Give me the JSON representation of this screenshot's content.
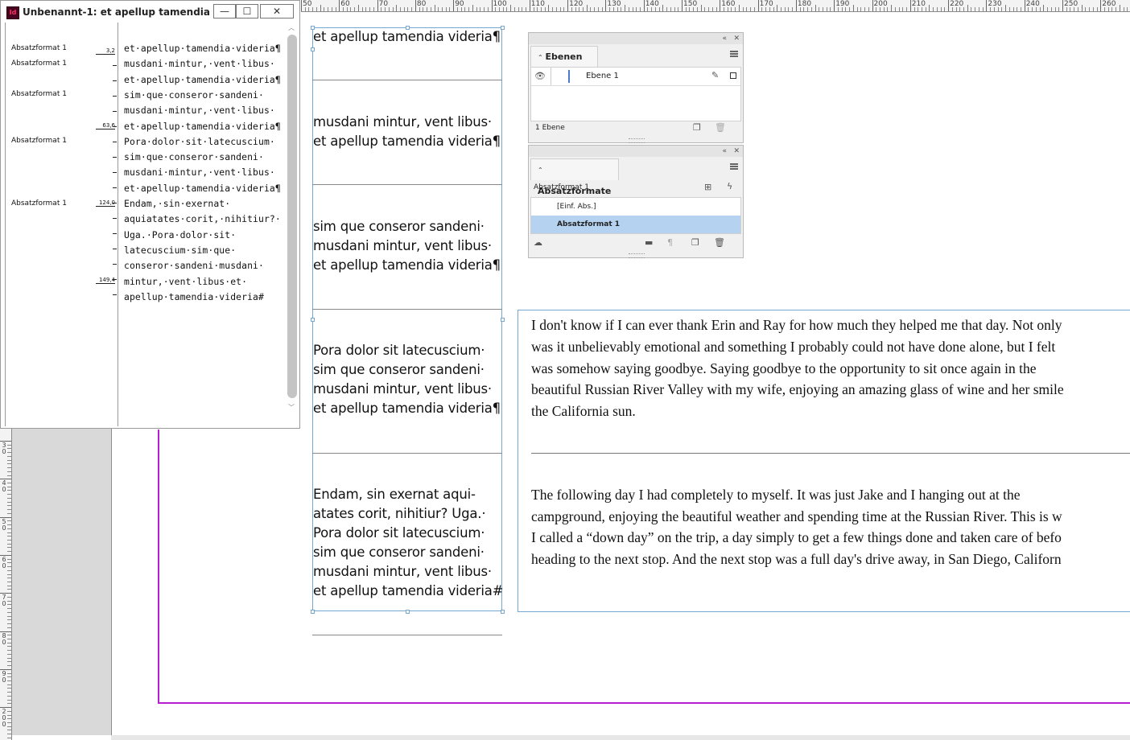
{
  "story_editor": {
    "title": "Unbenannt-1: et apellup tamendia ...",
    "controls": {
      "minimize": "—",
      "maximize": "☐",
      "close": "✕"
    },
    "style_labels": [
      "Absatzformat 1",
      "Absatzformat 1",
      "Absatzformat 1",
      "Absatzformat 1",
      "Absatzformat 1"
    ],
    "depth_marks": [
      "3,2",
      "63,6",
      "124,0",
      "149,4"
    ],
    "lines": [
      "et·apellup·tamendia·videria¶",
      "musdani·mintur,·vent·libus·",
      "et·apellup·tamendia·videria¶",
      "sim·que·conseror·sandeni·",
      "musdani·mintur,·vent·libus·",
      "et·apellup·tamendia·videria¶",
      "Pora·dolor·sit·latecuscium·",
      "sim·que·conseror·sandeni·",
      "musdani·mintur,·vent·libus·",
      "et·apellup·tamendia·videria¶",
      "Endam,·sin·exernat·",
      "aquiatates·corit,·nihitiur?·",
      "Uga.·Pora·dolor·sit·",
      "latecuscium·sim·que·",
      "conseror·sandeni·musdani·",
      "mintur,·vent·libus·et·",
      "apellup·tamendia·videria#"
    ]
  },
  "column_frame": {
    "blocks": [
      [
        "et apellup tamendia videria¶"
      ],
      [
        "musdani mintur, vent libus·",
        "et apellup tamendia videria¶"
      ],
      [
        "sim que conseror sandeni·",
        "musdani mintur, vent libus·",
        "et apellup tamendia videria¶"
      ],
      [
        "Pora dolor sit latecuscium·",
        "sim que conseror sandeni·",
        "musdani mintur, vent libus·",
        "et apellup tamendia videria¶"
      ],
      [
        "Endam, sin exernat aqui-",
        "atates corit, nihitiur? Uga.·",
        "Pora dolor sit latecuscium·",
        "sim que conseror sandeni·",
        "musdani mintur, vent libus·",
        "et apellup tamendia videria#"
      ]
    ]
  },
  "story_frame": {
    "para1": [
      "I don't know if I can ever thank Erin and Ray for how much they helped me that day. Not only",
      "was it unbelievably emotional and something I probably could not have done alone, but I felt",
      "was somehow saying goodbye. Saying goodbye to the opportunity to sit once again in the",
      "beautiful Russian River Valley with my wife, enjoying an amazing glass of wine and her smile",
      "the California sun."
    ],
    "para2": [
      "The following day I had completely to myself. It was just Jake and I hanging out at the",
      "campground, enjoying the beautiful weather and spending time at the Russian River. This is w",
      "I called a “down day” on the trip, a day simply to get a few things done and taken care of befo",
      "heading to the next stop. And the next stop was a full day's drive away, in San Diego, Californ"
    ]
  },
  "layers_panel": {
    "tab": "Ebenen",
    "layer_name": "Ebene 1",
    "footer": "1 Ebene",
    "icons": [
      "eye-icon",
      "pencil-icon",
      "new-layer-icon",
      "trash-icon"
    ]
  },
  "paragraph_styles_panel": {
    "tab": "Absatzformate",
    "current_style": "Absatzformat 1",
    "items": [
      "[Einf. Abs.]",
      "Absatzformat 1"
    ],
    "selected_index": 1,
    "selected_color": "#b5d3f0"
  },
  "ruler": {
    "top_labels": [
      "50",
      "60",
      "70",
      "80",
      "90",
      "100",
      "110",
      "120",
      "130",
      "140",
      "150",
      "160",
      "170",
      "180",
      "190",
      "200",
      "210",
      "220",
      "230",
      "240",
      "250",
      "260"
    ],
    "left_labels": [
      "30",
      "40",
      "50",
      "60",
      "70",
      "80",
      "90",
      "200"
    ]
  },
  "colors": {
    "page_margin": "#b620d1",
    "frame_edge": "#74a8d2",
    "pasteboard": "#d9d9d9"
  }
}
